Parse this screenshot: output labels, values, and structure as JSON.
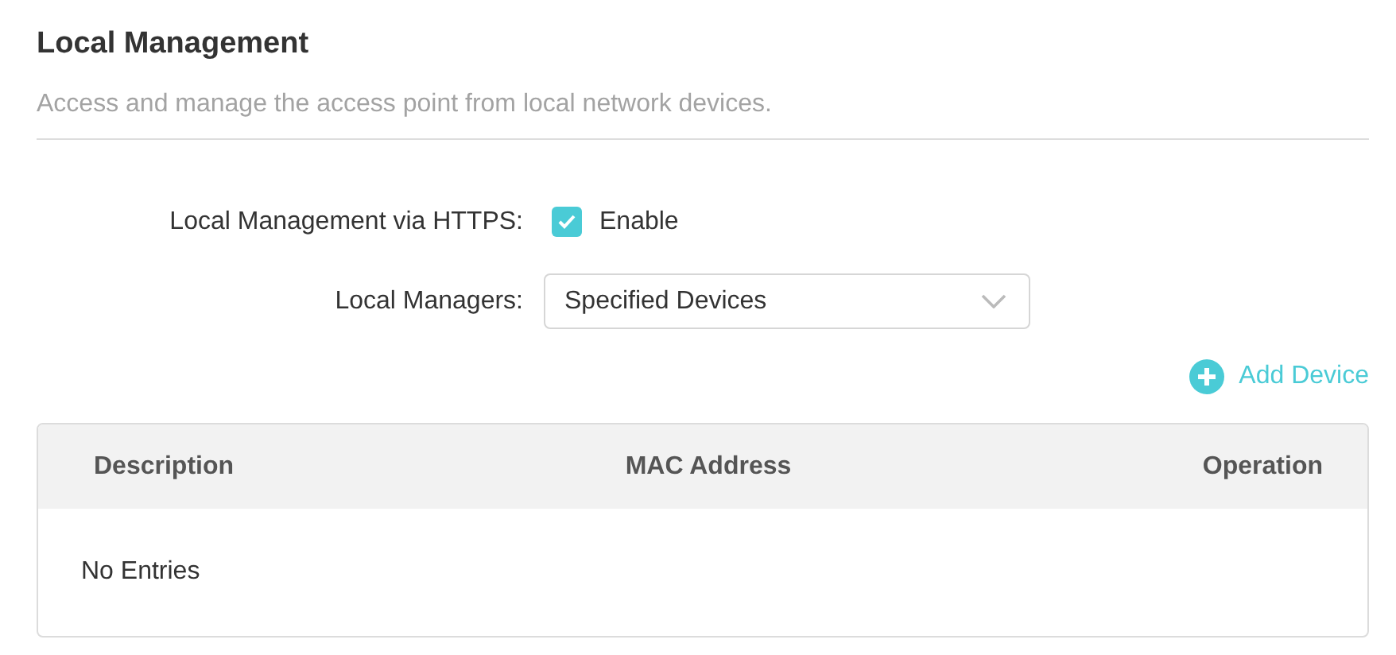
{
  "section": {
    "title": "Local Management",
    "description": "Access and manage the access point from local network devices."
  },
  "https_row": {
    "label": "Local Management via HTTPS:",
    "checkbox_label": "Enable",
    "checked": true
  },
  "managers_row": {
    "label": "Local Managers:",
    "value": "Specified Devices"
  },
  "add_button": {
    "label": "Add Device"
  },
  "table": {
    "columns": [
      "Description",
      "MAC Address",
      "Operation"
    ],
    "empty_text": "No Entries"
  }
}
